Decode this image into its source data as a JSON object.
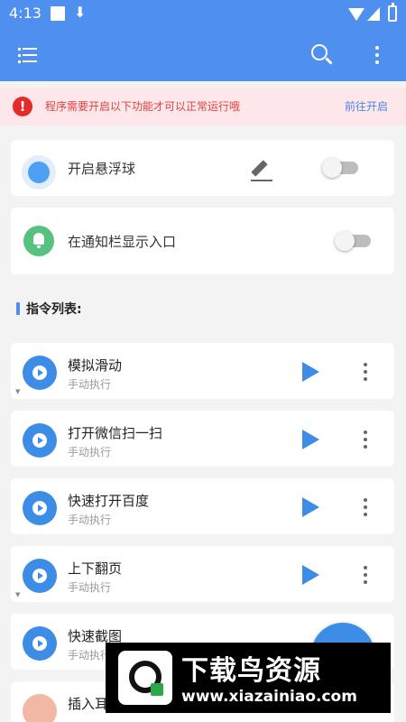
{
  "status_bar": {
    "time": "4:13"
  },
  "toolbar": {
    "menu_icon": "list-icon",
    "search_icon": "search-icon",
    "more_icon": "more-vert-icon"
  },
  "warning": {
    "icon": "error-icon",
    "text": "程序需要开启以下功能才可以正常运行哦",
    "action": "前往开启",
    "text_color": "#e14242",
    "bg_color": "#fde7ea"
  },
  "settings": {
    "floating_ball": {
      "label": "开启悬浮球",
      "icon": "floating-ball-icon",
      "edit_icon": "pencil-icon",
      "enabled": false
    },
    "notification_entry": {
      "label": "在通知栏显示入口",
      "icon": "bell-icon",
      "enabled": false
    }
  },
  "section": {
    "title": "指令列表:"
  },
  "commands": [
    {
      "name": "模拟滑动",
      "mode": "手动执行"
    },
    {
      "name": "打开微信扫一扫",
      "mode": "手动执行"
    },
    {
      "name": "快速打开百度",
      "mode": "手动执行"
    },
    {
      "name": "上下翻页",
      "mode": "手动执行"
    },
    {
      "name": "快速截图",
      "mode": "手动执行"
    },
    {
      "name": "插入耳",
      "mode": ""
    }
  ],
  "watermark": {
    "brand": "下载鸟资源",
    "url": "www.xiazainiao.com"
  },
  "colors": {
    "primary": "#4f8ff0",
    "accent": "#3d8de6",
    "green": "#57c17f"
  }
}
